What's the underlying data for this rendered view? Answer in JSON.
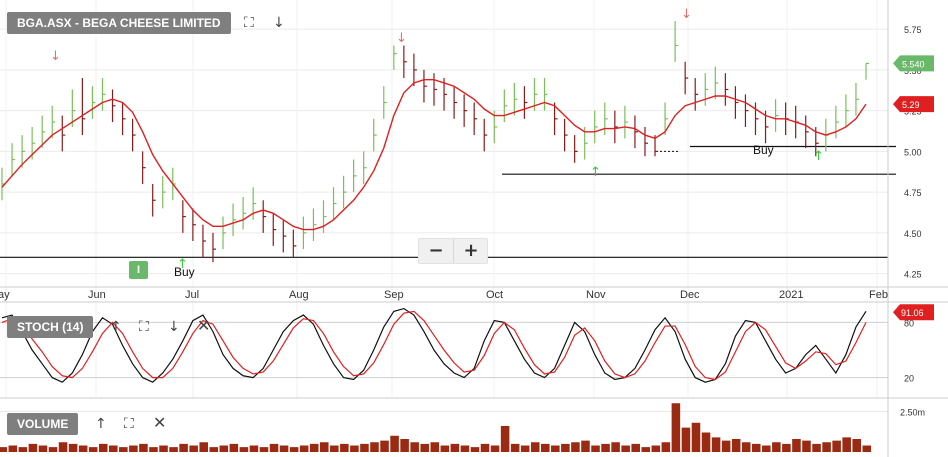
{
  "header": {
    "symbol_label": "BGA.ASX - BEGA CHEESE LIMITED",
    "stoch_label": "STOCH (14)",
    "volume_label": "VOLUME",
    "indicator_badge": "I"
  },
  "colors": {
    "up_bar": "#7bbf5a",
    "down_bar": "#8b1a1a",
    "ma_line": "#e02020",
    "stoch_k": "#111111",
    "stoch_d": "#e02020",
    "volume_bar": "#9b2a12",
    "price_tag": "#6ab86a",
    "ma_tag": "#e02020",
    "sell_arrow": "#e07070",
    "buy_arrow": "#33cc33",
    "panel_label_bg": "#7f7f7f"
  },
  "chart_data": {
    "type": "line",
    "title": "BGA.ASX - BEGA CHEESE LIMITED",
    "x_tick_labels": [
      "ay",
      "Jun",
      "Jul",
      "Aug",
      "Sep",
      "Oct",
      "Nov",
      "Dec",
      "2021",
      "Feb"
    ],
    "price_axis": {
      "ylim": [
        4.18,
        5.88
      ],
      "ticks": [
        "5.75",
        "5.50",
        "5.25",
        "5.00",
        "4.75",
        "4.50",
        "4.25"
      ]
    },
    "last_price": "5.540",
    "ma_value": "5.29",
    "price_close": [
      4.8,
      4.95,
      5.0,
      5.05,
      5.12,
      5.18,
      5.1,
      5.25,
      5.2,
      5.3,
      5.35,
      5.28,
      5.2,
      5.1,
      4.9,
      4.7,
      4.75,
      4.8,
      4.6,
      4.55,
      4.45,
      4.4,
      4.5,
      4.58,
      4.62,
      4.68,
      4.6,
      4.52,
      4.48,
      4.42,
      4.5,
      4.55,
      4.6,
      4.68,
      4.75,
      4.85,
      4.9,
      5.1,
      5.3,
      5.6,
      5.55,
      5.5,
      5.4,
      5.38,
      5.35,
      5.3,
      5.25,
      5.2,
      5.1,
      5.15,
      5.28,
      5.32,
      5.3,
      5.35,
      5.35,
      5.2,
      5.1,
      5.0,
      5.05,
      5.15,
      5.2,
      5.15,
      5.18,
      5.12,
      5.05,
      5.0,
      5.2,
      5.65,
      5.45,
      5.35,
      5.38,
      5.42,
      5.38,
      5.3,
      5.25,
      5.2,
      5.15,
      5.22,
      5.2,
      5.18,
      5.12,
      5.05,
      5.1,
      5.18,
      5.25,
      5.32,
      5.54
    ],
    "price_high": [
      4.9,
      5.05,
      5.1,
      5.15,
      5.22,
      5.28,
      5.22,
      5.38,
      5.45,
      5.4,
      5.45,
      5.38,
      5.3,
      5.2,
      5.0,
      4.8,
      4.85,
      4.9,
      4.7,
      4.65,
      4.55,
      4.5,
      4.6,
      4.68,
      4.72,
      4.78,
      4.7,
      4.62,
      4.58,
      4.52,
      4.6,
      4.65,
      4.7,
      4.78,
      4.85,
      4.95,
      5.0,
      5.2,
      5.4,
      5.65,
      5.65,
      5.6,
      5.5,
      5.48,
      5.45,
      5.4,
      5.35,
      5.3,
      5.2,
      5.25,
      5.38,
      5.42,
      5.4,
      5.45,
      5.45,
      5.3,
      5.2,
      5.1,
      5.15,
      5.25,
      5.3,
      5.25,
      5.28,
      5.22,
      5.15,
      5.1,
      5.3,
      5.8,
      5.55,
      5.45,
      5.48,
      5.52,
      5.48,
      5.4,
      5.35,
      5.3,
      5.25,
      5.32,
      5.3,
      5.28,
      5.22,
      5.15,
      5.2,
      5.28,
      5.35,
      5.42,
      5.54
    ],
    "price_low": [
      4.7,
      4.85,
      4.9,
      4.95,
      5.02,
      5.08,
      5.0,
      5.15,
      5.1,
      5.2,
      5.25,
      5.18,
      5.1,
      5.0,
      4.8,
      4.6,
      4.65,
      4.7,
      4.5,
      4.45,
      4.35,
      4.32,
      4.4,
      4.48,
      4.52,
      4.58,
      4.5,
      4.42,
      4.38,
      4.35,
      4.4,
      4.45,
      4.5,
      4.58,
      4.65,
      4.75,
      4.8,
      5.0,
      5.2,
      5.5,
      5.45,
      5.4,
      5.3,
      5.28,
      5.25,
      5.2,
      5.15,
      5.1,
      5.0,
      5.05,
      5.18,
      5.22,
      5.2,
      5.25,
      5.25,
      5.1,
      5.0,
      4.93,
      4.95,
      5.05,
      5.1,
      5.05,
      5.08,
      5.02,
      4.97,
      4.97,
      5.1,
      5.55,
      5.35,
      5.25,
      5.28,
      5.32,
      5.28,
      5.2,
      5.15,
      5.1,
      5.05,
      5.12,
      5.1,
      5.08,
      5.02,
      4.97,
      5.0,
      5.08,
      5.15,
      5.22,
      5.44
    ],
    "ma": [
      4.78,
      4.85,
      4.92,
      4.98,
      5.04,
      5.1,
      5.14,
      5.18,
      5.22,
      5.26,
      5.3,
      5.32,
      5.3,
      5.24,
      5.12,
      4.98,
      4.88,
      4.8,
      4.72,
      4.64,
      4.58,
      4.54,
      4.54,
      4.56,
      4.58,
      4.62,
      4.64,
      4.62,
      4.58,
      4.54,
      4.52,
      4.52,
      4.54,
      4.58,
      4.64,
      4.7,
      4.78,
      4.88,
      5.02,
      5.22,
      5.36,
      5.42,
      5.44,
      5.44,
      5.42,
      5.4,
      5.36,
      5.32,
      5.26,
      5.22,
      5.22,
      5.24,
      5.26,
      5.28,
      5.3,
      5.28,
      5.22,
      5.16,
      5.12,
      5.12,
      5.14,
      5.14,
      5.15,
      5.14,
      5.1,
      5.08,
      5.12,
      5.22,
      5.28,
      5.3,
      5.32,
      5.34,
      5.34,
      5.32,
      5.3,
      5.26,
      5.22,
      5.2,
      5.2,
      5.18,
      5.16,
      5.12,
      5.1,
      5.12,
      5.15,
      5.2,
      5.29
    ],
    "support_lines": [
      4.35,
      4.86,
      5.03
    ],
    "buy_labels": [
      "Buy",
      "Buy"
    ],
    "stoch_axis": {
      "ylim": [
        0,
        100
      ],
      "ticks": [
        "80",
        "20"
      ]
    },
    "stoch_value": "91.06",
    "stoch_k": [
      85,
      88,
      70,
      50,
      35,
      20,
      15,
      25,
      45,
      70,
      85,
      78,
      55,
      35,
      20,
      15,
      25,
      40,
      60,
      82,
      88,
      70,
      45,
      30,
      22,
      20,
      30,
      50,
      70,
      82,
      88,
      78,
      55,
      35,
      20,
      18,
      28,
      50,
      75,
      92,
      95,
      88,
      70,
      50,
      35,
      25,
      20,
      30,
      60,
      82,
      80,
      60,
      40,
      25,
      20,
      30,
      55,
      80,
      70,
      45,
      25,
      18,
      20,
      30,
      50,
      72,
      85,
      70,
      40,
      20,
      15,
      18,
      35,
      65,
      82,
      80,
      60,
      40,
      25,
      30,
      45,
      55,
      40,
      25,
      45,
      75,
      92
    ],
    "stoch_d": [
      80,
      84,
      78,
      62,
      48,
      32,
      22,
      20,
      30,
      48,
      68,
      80,
      68,
      48,
      30,
      20,
      20,
      30,
      48,
      68,
      82,
      78,
      60,
      42,
      30,
      24,
      26,
      38,
      56,
      74,
      84,
      82,
      68,
      48,
      32,
      22,
      24,
      36,
      56,
      78,
      90,
      92,
      82,
      66,
      50,
      36,
      26,
      28,
      44,
      68,
      80,
      72,
      52,
      34,
      24,
      26,
      42,
      66,
      74,
      60,
      38,
      24,
      20,
      24,
      38,
      58,
      76,
      76,
      56,
      32,
      20,
      18,
      26,
      48,
      70,
      80,
      72,
      54,
      36,
      30,
      38,
      48,
      46,
      34,
      38,
      58,
      80
    ],
    "volume_axis": {
      "tick": "2.50m"
    },
    "volume": [
      0.3,
      0.4,
      0.3,
      0.5,
      0.4,
      0.3,
      0.6,
      0.5,
      0.4,
      0.3,
      0.5,
      0.4,
      0.3,
      0.4,
      0.5,
      0.3,
      0.4,
      0.3,
      0.5,
      0.4,
      0.6,
      0.3,
      0.4,
      0.5,
      0.3,
      0.4,
      0.3,
      0.5,
      0.4,
      0.3,
      0.4,
      0.5,
      0.6,
      0.4,
      0.5,
      0.4,
      0.5,
      0.6,
      0.7,
      1.0,
      0.8,
      0.6,
      0.5,
      0.6,
      0.4,
      0.5,
      0.4,
      0.3,
      0.5,
      0.4,
      1.6,
      0.5,
      0.4,
      0.6,
      0.5,
      0.4,
      0.5,
      0.6,
      0.7,
      0.4,
      0.5,
      0.6,
      0.4,
      0.5,
      0.3,
      0.4,
      0.6,
      3.0,
      1.5,
      1.8,
      1.2,
      0.9,
      0.7,
      0.8,
      0.6,
      0.5,
      0.4,
      0.6,
      0.5,
      0.8,
      0.7,
      0.5,
      0.6,
      0.7,
      0.9,
      0.8,
      0.4
    ]
  }
}
